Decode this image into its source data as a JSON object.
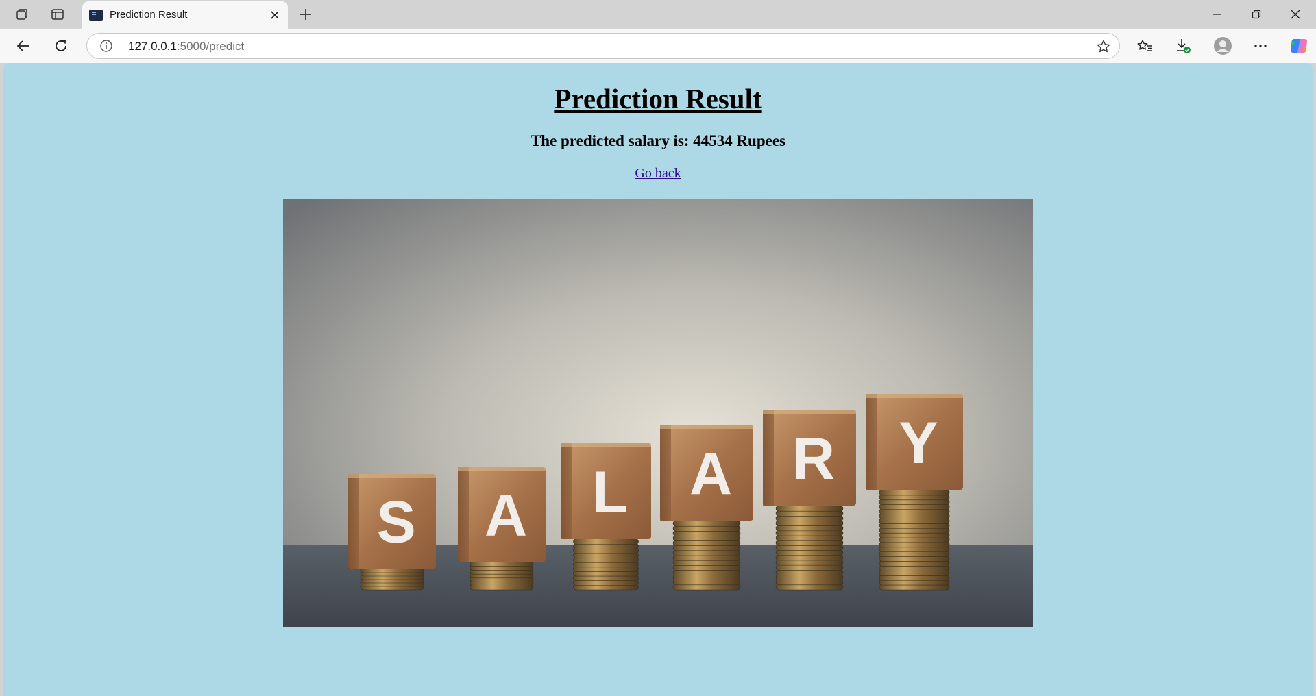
{
  "browser": {
    "tab": {
      "title": "Prediction Result"
    },
    "address": {
      "host": "127.0.0.1",
      "path": ":5000/predict"
    }
  },
  "page": {
    "heading": "Prediction Result",
    "result_text": "The predicted salary is: 44534 Rupees",
    "back_link": "Go back",
    "image": {
      "letters": [
        "S",
        "A",
        "L",
        "A",
        "R",
        "Y"
      ]
    }
  },
  "colors": {
    "page_background": "#add8e6",
    "link": "#2a0e8a"
  }
}
